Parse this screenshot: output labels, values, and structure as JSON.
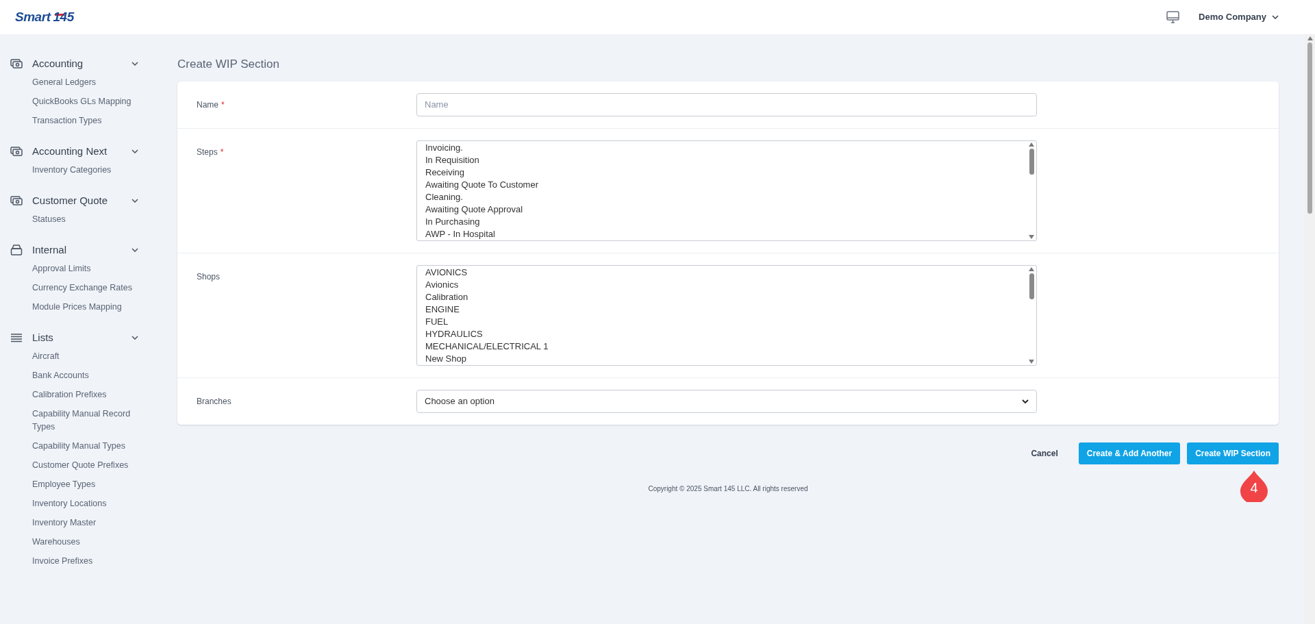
{
  "header": {
    "logo": {
      "word": "Smart",
      "number": "145"
    },
    "company": "Demo Company"
  },
  "sidebar": {
    "sections": [
      {
        "title": "Accounting",
        "kind": "cash",
        "expanded": true,
        "items": [
          "General Ledgers",
          "QuickBooks GLs Mapping",
          "Transaction Types"
        ]
      },
      {
        "title": "Accounting Next",
        "kind": "cash",
        "expanded": true,
        "items": [
          "Inventory Categories"
        ]
      },
      {
        "title": "Customer Quote",
        "kind": "cash",
        "expanded": true,
        "items": [
          "Statuses"
        ]
      },
      {
        "title": "Internal",
        "kind": "box",
        "expanded": true,
        "items": [
          "Approval Limits",
          "Currency Exchange Rates",
          "Module Prices Mapping"
        ]
      },
      {
        "title": "Lists",
        "kind": "lines",
        "expanded": true,
        "items": [
          "Aircraft",
          "Bank Accounts",
          "Calibration Prefixes",
          "Capability Manual Record Types",
          "Capability Manual Types",
          "Customer Quote Prefixes",
          "Employee Types",
          "Inventory Locations",
          "Inventory Master",
          "Warehouses",
          "Invoice Prefixes"
        ]
      }
    ]
  },
  "page": {
    "title": "Create WIP Section"
  },
  "form": {
    "fields": [
      {
        "kind": "text",
        "label": "Name",
        "required_mark": "*",
        "placeholder": "Name"
      },
      {
        "kind": "multiselect",
        "label": "Steps",
        "required_mark": "*",
        "options": [
          "Invoicing.",
          "In Requisition",
          "Receiving",
          "Awaiting Quote To Customer",
          "Cleaning.",
          "Awaiting Quote Approval",
          "In Purchasing",
          "AWP - In Hospital"
        ]
      },
      {
        "kind": "multiselect",
        "label": "Shops",
        "options": [
          "AVIONICS",
          "Avionics",
          "Calibration",
          "ENGINE",
          "FUEL",
          "HYDRAULICS",
          "MECHANICAL/ELECTRICAL 1",
          "New Shop"
        ]
      },
      {
        "kind": "select",
        "label": "Branches",
        "placeholder": "Choose an option"
      }
    ]
  },
  "actions": [
    {
      "kind": "link",
      "label": "Cancel"
    },
    {
      "kind": "primary",
      "label": "Create & Add Another"
    },
    {
      "kind": "primary",
      "label": "Create WIP Section"
    }
  ],
  "callout": {
    "number": "4"
  },
  "footer": "Copyright © 2025 Smart 145 LLC. All rights reserved"
}
